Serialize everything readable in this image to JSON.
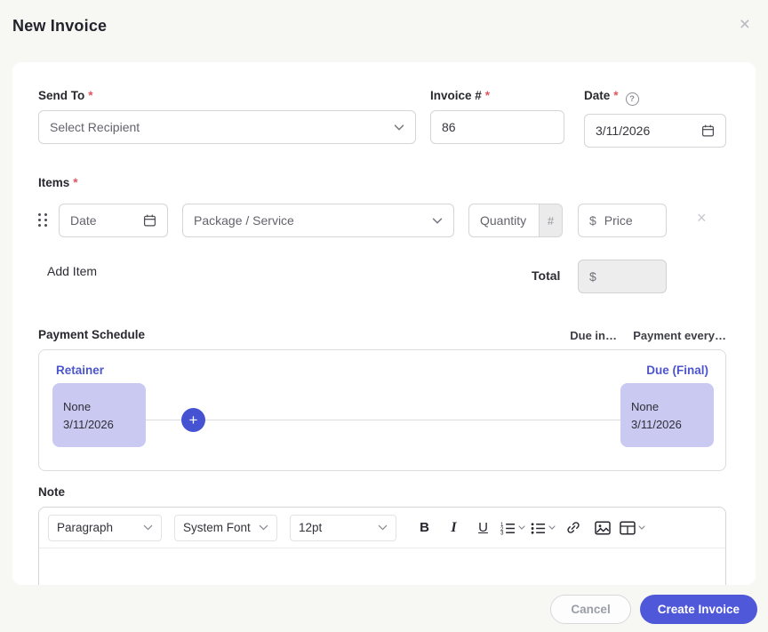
{
  "header": {
    "title": "New Invoice",
    "close_icon": "×"
  },
  "form": {
    "send_to": {
      "label": "Send To",
      "required_mark": "*",
      "placeholder": "Select Recipient"
    },
    "invoice_number": {
      "label": "Invoice #",
      "required_mark": "*",
      "value": "86"
    },
    "date": {
      "label": "Date",
      "required_mark": "*",
      "value": "3/11/2026",
      "help_icon": "?"
    }
  },
  "items": {
    "label": "Items",
    "required_mark": "*",
    "row": {
      "date_placeholder": "Date",
      "package_placeholder": "Package / Service",
      "quantity_placeholder": "Quantity",
      "quantity_unit": "#",
      "price_currency": "$",
      "price_placeholder": "Price",
      "remove_icon": "×"
    },
    "add_item": "Add Item",
    "total": {
      "label": "Total",
      "currency": "$"
    }
  },
  "payment_schedule": {
    "label": "Payment Schedule",
    "due_in": "Due in…",
    "payment_every": "Payment every…",
    "retainer": {
      "title": "Retainer",
      "value": "None",
      "date": "3/11/2026"
    },
    "due_final": {
      "title": "Due (Final)",
      "value": "None",
      "date": "3/11/2026"
    },
    "add_icon": "+"
  },
  "note": {
    "label": "Note",
    "toolbar": {
      "block_format": "Paragraph",
      "font_family": "System Font",
      "font_size": "12pt",
      "bold": "B",
      "italic": "I",
      "underline": "U"
    }
  },
  "footer": {
    "cancel": "Cancel",
    "create": "Create Invoice"
  },
  "colors": {
    "accent": "#4f58d8",
    "light_purple": "#c9c9f1",
    "required_red": "#e05561"
  }
}
